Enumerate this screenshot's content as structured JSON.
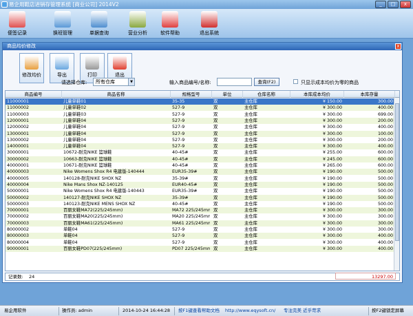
{
  "app": {
    "title": "易企用鞋店进销存管理系统 [商业公司] 2014V2"
  },
  "toolbar": [
    {
      "label": "便签记录",
      "color": "#e05050"
    },
    {
      "label": "换班管理",
      "color": "#5b9ad8"
    },
    {
      "label": "单据查询",
      "color": "#4f8fd0"
    },
    {
      "label": "营业分析",
      "color": "#8aa840"
    },
    {
      "label": "软件帮助",
      "color": "#e04040"
    },
    {
      "label": "退出系统",
      "color": "#d03030"
    }
  ],
  "dialog": {
    "title": "商品均价修改",
    "tools": [
      "修改均价",
      "导出",
      "打印",
      "退出"
    ],
    "wh_label": "请选择仓库:",
    "wh_value": "所有仓库",
    "search_label": "输入商品编号/名称:",
    "query_button": "查询(F2)",
    "zero_only": "只显示成本均价为零的商品",
    "columns": [
      "商品编号",
      "商品名称",
      "规格型号",
      "单位",
      "仓库名称",
      "本库成本均价",
      "本库存量"
    ],
    "rows": [
      [
        "11000001",
        "儿童单鞋01",
        "35-35",
        "双",
        "主仓库",
        "¥ 150.00",
        "300.00"
      ],
      [
        "11000002",
        "儿童单鞋02",
        "527-9",
        "双",
        "主仓库",
        "¥ 300.00",
        "400.00"
      ],
      [
        "11000003",
        "儿童单鞋03",
        "527-9",
        "双",
        "主仓库",
        "¥ 300.00",
        "699.00"
      ],
      [
        "12000001",
        "儿童单鞋04",
        "527-9",
        "双",
        "主仓库",
        "¥ 300.00",
        "200.00"
      ],
      [
        "12000002",
        "儿童单鞋04",
        "527-9",
        "双",
        "主仓库",
        "¥ 300.00",
        "400.00"
      ],
      [
        "13000001",
        "儿童单鞋04",
        "527-9",
        "双",
        "主仓库",
        "¥ 300.00",
        "100.00"
      ],
      [
        "13000002",
        "儿童单鞋04",
        "527-9",
        "双",
        "主仓库",
        "¥ 300.00",
        "200.00"
      ],
      [
        "14000001",
        "儿童单鞋04",
        "527-9",
        "双",
        "主仓库",
        "¥ 300.00",
        "400.00"
      ],
      [
        "30000001",
        "10672-耐克NIKE 篮球鞋",
        "40-45#",
        "双",
        "主仓库",
        "¥ 255.00",
        "600.00"
      ],
      [
        "30000002",
        "10663-耐克NIKE 篮球鞋",
        "40-45#",
        "双",
        "主仓库",
        "¥ 245.00",
        "600.00"
      ],
      [
        "40000001",
        "10671-耐克NIKE 篮球鞋",
        "40-45#",
        "双",
        "主仓库",
        "¥ 265.00",
        "600.00"
      ],
      [
        "40000003",
        "Nike Womens Shox R4 电建版-140444",
        "EUR35-39#",
        "双",
        "主仓库",
        "¥ 190.00",
        "500.00"
      ],
      [
        "40000005",
        "140128-耐克NIKE SHOX NZ",
        "35-39#",
        "双",
        "主仓库",
        "¥ 190.00",
        "500.00"
      ],
      [
        "40000004",
        "Nike Mans Shox NZ-140125",
        "EUR40-45#",
        "双",
        "主仓库",
        "¥ 190.00",
        "500.00"
      ],
      [
        "50000001",
        "Nike Womens Shox R4 电建版-140443",
        "EUR35-39#",
        "双",
        "主仓库",
        "¥ 190.00",
        "500.00"
      ],
      [
        "50000002",
        "140127-耐克NIKE SHOX NZ",
        "35-39#",
        "双",
        "主仓库",
        "¥ 190.00",
        "500.00"
      ],
      [
        "50000003",
        "140123-耐克NIKE MENS SHOX NZ",
        "40-45#",
        "双",
        "主仓库",
        "¥ 190.00",
        "500.00"
      ],
      [
        "70000001",
        "百丽女鞋MA72(225/245mm)",
        "MA72 225/245mm",
        "双",
        "主仓库",
        "¥ 300.00",
        "300.00"
      ],
      [
        "70000002",
        "百丽女鞋MA20(225/245mm)",
        "MA20 225/245mm",
        "双",
        "主仓库",
        "¥ 300.00",
        "300.00"
      ],
      [
        "70000003",
        "百丽女鞋MA61(225/245mm)",
        "MA61 225/245mm",
        "双",
        "主仓库",
        "¥ 300.00",
        "300.00"
      ],
      [
        "80000002",
        "单鞋04",
        "527-9",
        "双",
        "主仓库",
        "¥ 300.00",
        "300.00"
      ],
      [
        "80000003",
        "单鞋04",
        "527-9",
        "双",
        "主仓库",
        "¥ 300.00",
        "400.00"
      ],
      [
        "80000004",
        "单鞋04",
        "527-9",
        "双",
        "主仓库",
        "¥ 300.00",
        "400.00"
      ],
      [
        "90000001",
        "百丽女鞋PD07(225/245mm)",
        "PD07 225/245mm",
        "双",
        "主仓库",
        "¥ 300.00",
        "400.00"
      ]
    ],
    "record_label": "记录数:",
    "record_count": "24",
    "total_stock": "13297.00"
  },
  "status": {
    "company": "易企用软件",
    "operator": "操作员: admin",
    "datetime": "2014-10-24 16:44:28",
    "help": "按F1键查看帮助文档",
    "url": "http://www.eqysoft.cn/",
    "slogan": "专注完美 近乎苛求",
    "lock": "按F2键锁定屏幕"
  }
}
